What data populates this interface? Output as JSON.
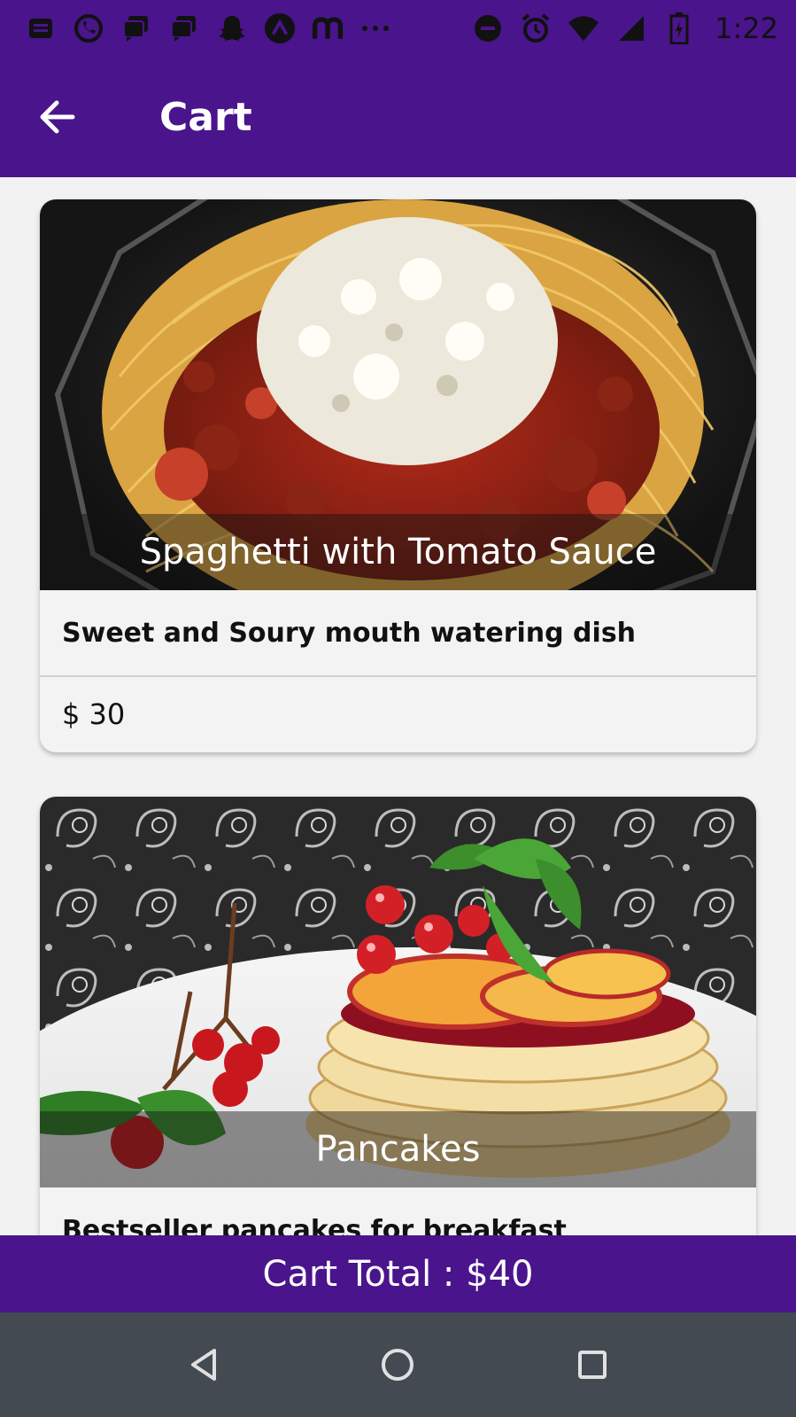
{
  "status_bar": {
    "time": "1:22",
    "icons_left": [
      "message-icon",
      "whatsapp-icon",
      "chat-icon",
      "chat-icon",
      "snapchat-icon",
      "arc-icon",
      "m-icon",
      "more-dots-icon"
    ],
    "icons_right": [
      "dnd-icon",
      "alarm-icon",
      "wifi-icon",
      "signal-icon",
      "battery-icon"
    ]
  },
  "app_bar": {
    "title": "Cart",
    "back_icon": "arrow-left-icon",
    "color": "#4a148c"
  },
  "cart_items": [
    {
      "name": "Spaghetti with Tomato Sauce",
      "description": "Sweet and Soury mouth watering dish",
      "price": "$ 30"
    },
    {
      "name": "Pancakes",
      "description": "Bestseller pancakes for breakfast",
      "price": ""
    }
  ],
  "cart_total": {
    "label": "Cart Total : $40"
  },
  "nav_bar": {
    "buttons": [
      "back-triangle-icon",
      "home-circle-icon",
      "recents-square-icon"
    ]
  }
}
